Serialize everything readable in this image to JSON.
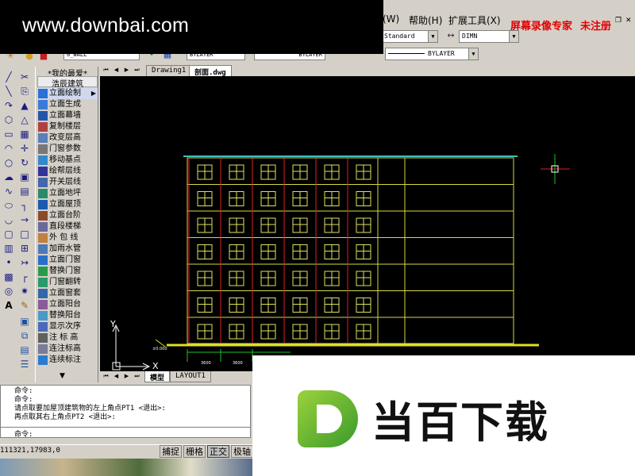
{
  "watermark": {
    "top_text": "www.downbai.com",
    "bottom_text": "当百下载"
  },
  "menu": {
    "items": [
      "(W)",
      "帮助(H)",
      "扩展工具(X)"
    ]
  },
  "promo": {
    "recorder": "屏幕录像专家",
    "unregistered": "未注册"
  },
  "toolbar": {
    "text_style": "Standard",
    "dim_style": "DIMN",
    "layer": "0_WALL",
    "linetype": "BYLAYER",
    "lineweight": "BYLAYER",
    "plot_style": "BYLAYER"
  },
  "panel": {
    "favorite": "*我的最爱*",
    "header": "浩辰建筑",
    "items": [
      {
        "label": "立面绘制",
        "active": true,
        "color": "#2c6fd6"
      },
      {
        "label": "立面生成",
        "color": "#3a7ad8"
      },
      {
        "label": "立面幕墙",
        "color": "#2255aa"
      },
      {
        "label": "复制楼层",
        "color": "#b04040"
      },
      {
        "label": "改变层高",
        "color": "#5b7fb8"
      },
      {
        "label": "门窗参数",
        "color": "#777777"
      },
      {
        "label": "移动基点",
        "color": "#3388cc"
      },
      {
        "label": "绘帮层线",
        "color": "#333399"
      },
      {
        "label": "开关层线",
        "color": "#4466aa"
      },
      {
        "label": "立面地坪",
        "color": "#2a8a6a"
      },
      {
        "label": "立面屋顶",
        "color": "#1a5ab0"
      },
      {
        "label": "立面台阶",
        "color": "#8a4a2a"
      },
      {
        "label": "直段楼梯",
        "color": "#6a6a9a"
      },
      {
        "label": "外 包 线",
        "color": "#c08040"
      },
      {
        "label": "加雨水管",
        "color": "#4a7ab8"
      },
      {
        "label": "立面门窗",
        "color": "#2a70c8"
      },
      {
        "label": "替换门窗",
        "color": "#2a9a4a"
      },
      {
        "label": "门窗翻转",
        "color": "#2a9a6a"
      },
      {
        "label": "立面窗套",
        "color": "#3366aa"
      },
      {
        "label": "立面阳台",
        "color": "#8a5a9a"
      },
      {
        "label": "替换阳台",
        "color": "#4a9ac8"
      },
      {
        "label": "显示次序",
        "color": "#4a6ab8"
      },
      {
        "label": "注 标 高",
        "color": "#606060"
      },
      {
        "label": "连注标高",
        "color": "#7a7a9a"
      },
      {
        "label": "连续标注",
        "color": "#2a7ad0"
      }
    ]
  },
  "tabs": {
    "drawing1": "Drawing1",
    "section": "剖面.dwg"
  },
  "layout_tabs": {
    "model": "模型",
    "layout1": "LAYOUT1"
  },
  "canvas": {
    "ground_label": "±0.000",
    "dims": [
      "3600",
      "3600"
    ],
    "axis_y": "Y",
    "axis_x": "X"
  },
  "command": {
    "lines": [
      "命令:",
      "命令:",
      "请点取要加屋顶建筑物的左上角点PT1 <退出>:",
      "再点取其右上角点PT2 <退出>:"
    ],
    "prompt": "命令:"
  },
  "status": {
    "coords": "111321,17983,0",
    "buttons": [
      "捕捉",
      "栅格",
      "正交",
      "极轴"
    ]
  }
}
